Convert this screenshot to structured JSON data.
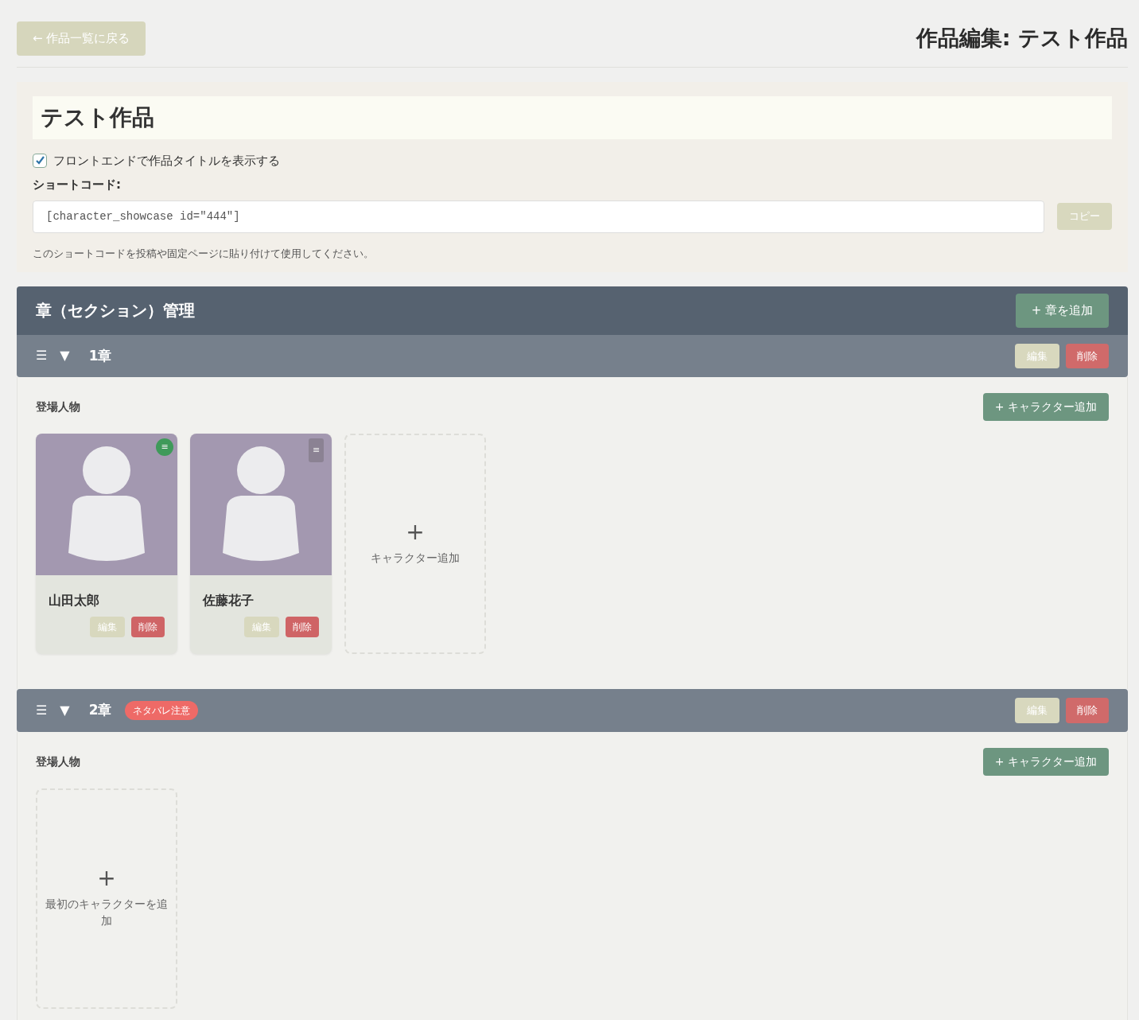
{
  "back_button": {
    "label": "← 作品一覧に戻る"
  },
  "page_title": "作品編集: テスト作品",
  "work": {
    "title": "テスト作品",
    "show_title": {
      "label": "フロントエンドで作品タイトルを表示する",
      "checked": true
    },
    "shortcode_label": "ショートコード:",
    "shortcode_value": "[character_showcase id=\"444\"]",
    "copy_button": "コピー",
    "hint": "このショートコードを投稿や固定ページに貼り付けて使用してください。"
  },
  "sections_panel": {
    "title": "章（セクション）管理",
    "add_button": "+ 章を追加"
  },
  "chapters": [
    {
      "handle": "☰",
      "toggle": "▼",
      "expanded": true,
      "title": "1章",
      "edit_button": "編集",
      "delete_button": "削除",
      "characters_heading": "登場人物",
      "add_character_button": "+ キャラクター追加",
      "characters": [
        {
          "name": "山田太郎",
          "handle": "≡",
          "highlighted": true,
          "edit_button": "編集",
          "delete_button": "削除"
        },
        {
          "name": "佐藤花子",
          "handle": "≡",
          "highlighted": false,
          "edit_button": "編集",
          "delete_button": "削除"
        }
      ],
      "add_tile": {
        "plus": "+",
        "label": "キャラクター追加"
      }
    },
    {
      "handle": "☰",
      "toggle": "▼",
      "expanded": true,
      "title": "2章",
      "badge": "ネタバレ注意",
      "edit_button": "編集",
      "delete_button": "削除",
      "characters_heading": "登場人物",
      "add_character_button": "+ キャラクター追加",
      "add_tile": {
        "plus": "+",
        "label": "最初のキャラクターを追加"
      }
    }
  ]
}
